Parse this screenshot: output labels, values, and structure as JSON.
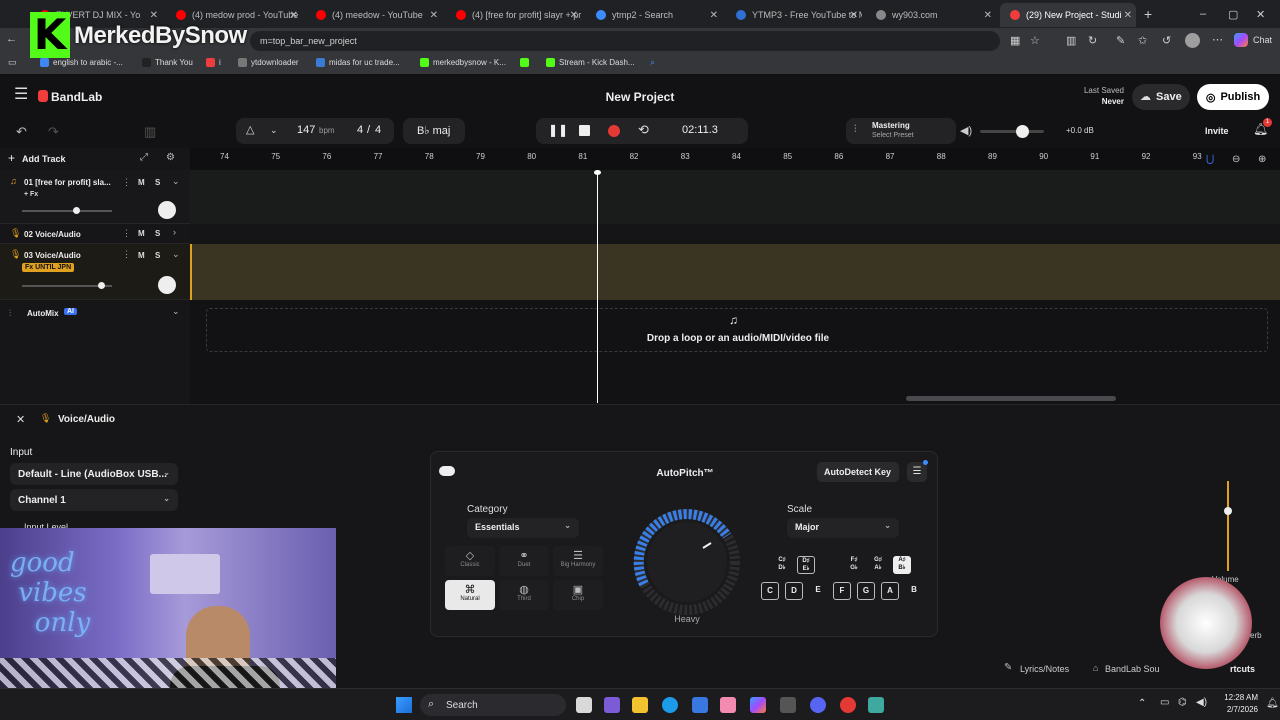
{
  "browser": {
    "tabs": [
      {
        "label": "ZI VERT DJ MIX - Yo",
        "color": "#ff0000"
      },
      {
        "label": "(4) medow prod - YouTube",
        "color": "#ff0000"
      },
      {
        "label": "(4) meedow - YouTube",
        "color": "#ff0000"
      },
      {
        "label": "(4) [free for profit] slayr + pr",
        "color": "#ff0000"
      },
      {
        "label": "ytmp2 - Search",
        "color": "#3c8bff"
      },
      {
        "label": "YTMP3 - Free YouTube to M",
        "color": "#2f6fd6"
      },
      {
        "label": "wy903.com",
        "color": "#888888"
      },
      {
        "label": "(29) New Project - Studi",
        "color": "#f03c3c"
      }
    ],
    "address": "m=top_bar_new_project",
    "bookmarks": [
      "english to arabic -...",
      "Thank You",
      "i",
      "ytdownloader",
      "midas for uc trade...",
      "merkedbysnow - K...",
      "Stream - Kick Dash..."
    ],
    "chat_label": "Chat"
  },
  "overlay": {
    "channel_name": "MerkedBySnow",
    "kick_letter": "K"
  },
  "app": {
    "brand": "BandLab",
    "project_title": "New Project",
    "last_saved_label": "Last Saved",
    "last_saved_value": "Never",
    "save_label": "Save",
    "publish_label": "Publish",
    "bpm_value": "147",
    "bpm_unit": "bpm",
    "time_sig_top": "4",
    "time_sig_sep": "/",
    "time_sig_bottom": "4",
    "key": "B♭ maj",
    "time_display": "02:11.3",
    "mastering_label": "Mastering",
    "mastering_preset": "Select Preset",
    "volume_db": "+0.0 dB",
    "invite_label": "Invite",
    "notification_count": "1",
    "add_track_label": "Add Track",
    "ruler_ticks": [
      "74",
      "75",
      "76",
      "77",
      "78",
      "79",
      "80",
      "81",
      "82",
      "83",
      "84",
      "85",
      "86",
      "87",
      "88",
      "89",
      "90",
      "91",
      "92",
      "93"
    ],
    "tracks": [
      {
        "name": "01  [free for profit] sla...",
        "fx": "+ Fx"
      },
      {
        "name": "02  Voice/Audio"
      },
      {
        "name": "03  Voice/Audio",
        "fx": "Fx UNTIL JPN"
      }
    ],
    "mute_label": "M",
    "solo_label": "S",
    "automix_label": "AutoMix",
    "automix_badge": "AI",
    "drop_text": "Drop a loop or an audio/MIDI/video file",
    "colors": {
      "accent_yellow": "#e0a020",
      "record_red": "#e53935",
      "brand_red": "#f03c3c"
    }
  },
  "editor": {
    "title": "Voice/Audio",
    "input_label": "Input",
    "input_device": "Default - Line (AudioBox USB...",
    "channel": "Channel 1",
    "input_level_label": "Input Level",
    "autopitch_title": "AutoPitch™",
    "autodetect_label": "AutoDetect Key",
    "category_label": "Category",
    "category_value": "Essentials",
    "presets": [
      "Classic",
      "Duet",
      "Big Harmony",
      "Natural",
      "Third",
      "Chip"
    ],
    "knob_label": "Heavy",
    "scale_label": "Scale",
    "scale_value": "Major",
    "keys_sharp": [
      [
        "C♯",
        "D♭"
      ],
      [
        "D♯",
        "E♭"
      ],
      [
        "F♯",
        "G♭"
      ],
      [
        "G♯",
        "A♭"
      ],
      [
        "A♯",
        "B♭"
      ]
    ],
    "keys_natural": [
      "C",
      "D",
      "E",
      "F",
      "G",
      "A",
      "B"
    ],
    "volume_label": "Volume",
    "reverb_label": "erb",
    "lyrics_label": "Lyrics/Notes",
    "sounds_label": "BandLab Sou",
    "shortcuts_label": "rtcuts"
  },
  "taskbar": {
    "search_label": "Search",
    "time": "12:28 AM",
    "date": "2/7/2026"
  }
}
